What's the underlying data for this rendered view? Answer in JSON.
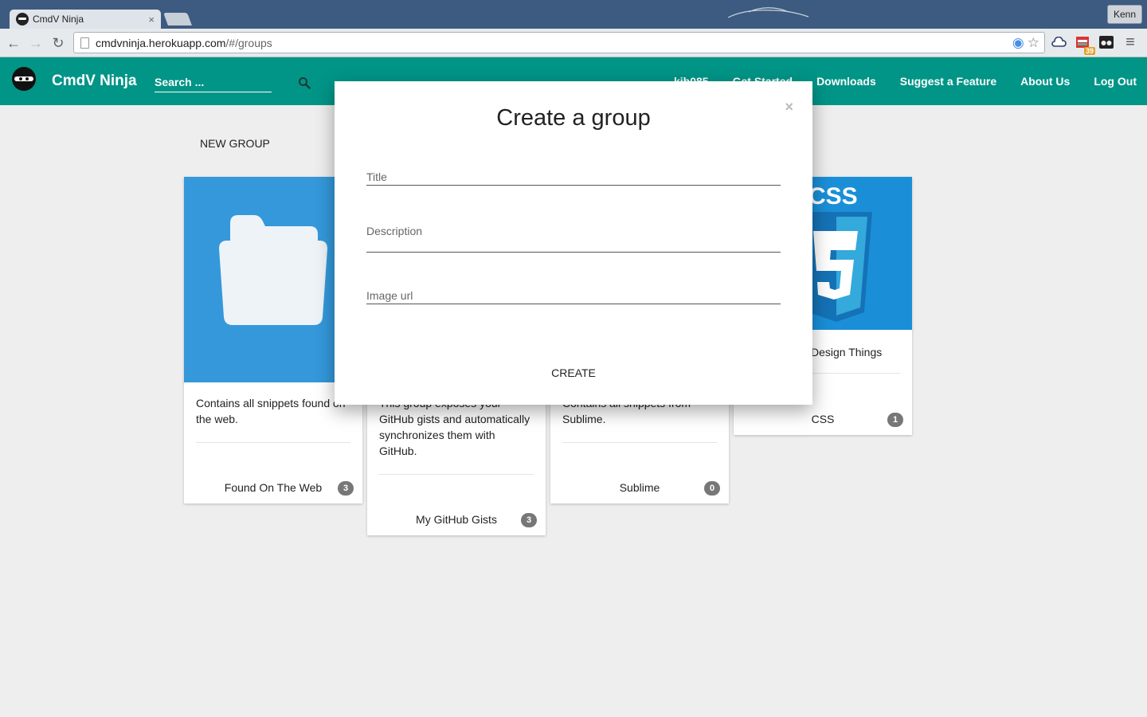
{
  "browser": {
    "tab_title": "CmdV Ninja",
    "tab_close": "×",
    "url_host": "cmdvninja.herokuapp.com",
    "url_path": "/#/groups",
    "profile_name": "Kenn",
    "extension_badge": "39"
  },
  "navbar": {
    "brand": "CmdV Ninja",
    "search_placeholder": "Search ...",
    "links": [
      "kjb085",
      "Get Started",
      "Downloads",
      "Suggest a Feature",
      "About Us",
      "Log Out"
    ]
  },
  "page": {
    "new_group_label": "NEW GROUP",
    "cards": [
      {
        "description": "Contains all snippets found on the web.",
        "title": "Found On The Web",
        "count": "3",
        "image": "folder-icon"
      },
      {
        "description": "This group exposes your GitHub gists and automatically synchronizes them with GitHub.",
        "title": "My GitHub Gists",
        "count": "3",
        "image": "none"
      },
      {
        "description": "Contains all snippets from Sublime.",
        "title": "Sublime",
        "count": "0",
        "image": "none"
      },
      {
        "description": "Design Things",
        "title": "CSS",
        "count": "1",
        "image": "css3-logo"
      }
    ]
  },
  "modal": {
    "title": "Create a group",
    "close_label": "×",
    "fields": {
      "title_placeholder": "Title",
      "description_placeholder": "Description",
      "image_url_placeholder": "Image url"
    },
    "create_label": "CREATE"
  },
  "colors": {
    "appbar": "#009587",
    "card_image_bg": "#3498db",
    "badge": "#777777"
  }
}
